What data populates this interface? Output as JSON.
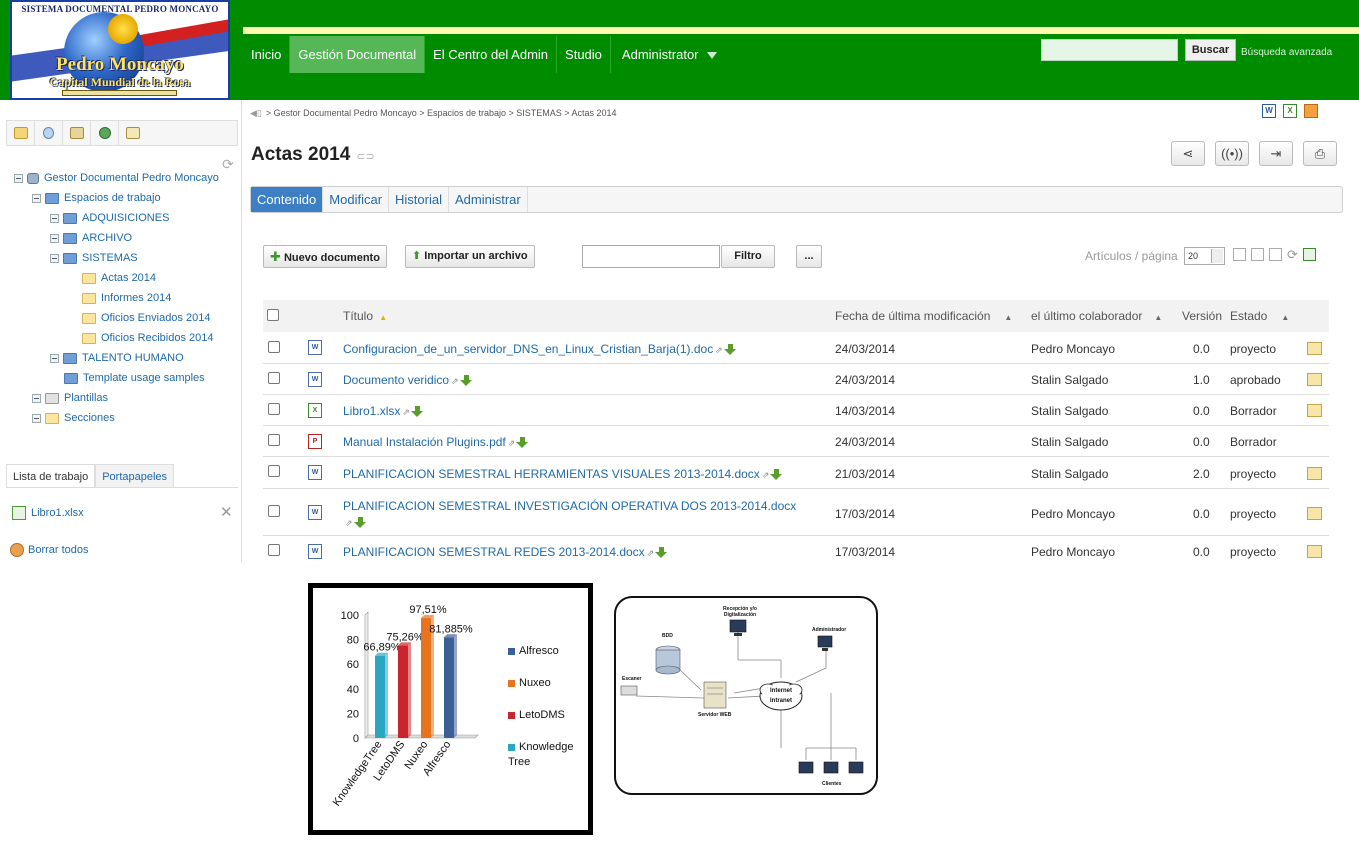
{
  "logo": {
    "top_text": "SISTEMA DOCUMENTAL PEDRO MONCAYO",
    "name": "Pedro Moncayo",
    "tagline": "Capital Mundial de la Rosa"
  },
  "nav": {
    "items": [
      "Inicio",
      "Gestión Documental",
      "El Centro del Admin",
      "Studio",
      "Administrator"
    ],
    "active_index": 1
  },
  "search": {
    "button": "Buscar",
    "advanced": "Búsqueda avanzada",
    "placeholder": ""
  },
  "sidebar": {
    "tree": {
      "root": "Gestor Documental Pedro Moncayo",
      "workspaces": "Espacios de trabajo",
      "adquisiciones": "ADQUISICIONES",
      "archivo": "ARCHIVO",
      "sistemas": "SISTEMAS",
      "actas": "Actas 2014",
      "informes": "Informes 2014",
      "oficios_enviados": "Oficios Enviados 2014",
      "oficios_recibidos": "Oficios Recibidos 2014",
      "talento": "TALENTO HUMANO",
      "template": "Template usage samples",
      "plantillas": "Plantillas",
      "secciones": "Secciones"
    },
    "work_tabs": [
      "Lista de trabajo",
      "Portapapeles"
    ],
    "worklist_item": "Libro1.xlsx",
    "clear_all": "Borrar todos"
  },
  "breadcrumb": "> Gestor Documental Pedro Moncayo > Espacios de trabajo > SISTEMAS > Actas 2014",
  "page_title": "Actas 2014",
  "tabs": [
    "Contenido",
    "Modificar",
    "Historial",
    "Administrar"
  ],
  "toolbar": {
    "new_doc": "Nuevo documento",
    "import": "Importar un archivo",
    "filter": "Filtro",
    "more": "...",
    "per_page_label": "Artículos / página",
    "per_page_value": "20"
  },
  "table": {
    "headers": {
      "title": "Título",
      "modified": "Fecha de última modificación",
      "contributor": "el último colaborador",
      "version": "Versión",
      "state": "Estado"
    },
    "rows": [
      {
        "type": "doc",
        "title": "Configuracion_de_un_servidor_DNS_en_Linux_Cristian_Barja(1).doc",
        "date": "24/03/2014",
        "author": "Pedro Moncayo",
        "version": "0.0",
        "state": "proyecto",
        "editable": true
      },
      {
        "type": "doc",
        "title": "Documento veridico",
        "date": "24/03/2014",
        "author": "Stalin Salgado",
        "version": "1.0",
        "state": "aprobado",
        "editable": true
      },
      {
        "type": "xls",
        "title": "Libro1.xlsx",
        "date": "14/03/2014",
        "author": "Stalin Salgado",
        "version": "0.0",
        "state": "Borrador",
        "editable": true
      },
      {
        "type": "pdf",
        "title": "Manual Instalación Plugins.pdf",
        "date": "24/03/2014",
        "author": "Stalin Salgado",
        "version": "0.0",
        "state": "Borrador",
        "editable": false
      },
      {
        "type": "doc",
        "title": "PLANIFICACION SEMESTRAL HERRAMIENTAS VISUALES 2013-2014.docx",
        "date": "21/03/2014",
        "author": "Stalin Salgado",
        "version": "2.0",
        "state": "proyecto",
        "editable": true
      },
      {
        "type": "doc",
        "title": "PLANIFICACION SEMESTRAL INVESTIGACIÓN OPERATIVA DOS 2013-2014.docx",
        "date": "17/03/2014",
        "author": "Pedro Moncayo",
        "version": "0.0",
        "state": "proyecto",
        "editable": true
      },
      {
        "type": "doc",
        "title": "PLANIFICACION SEMESTRAL REDES 2013-2014.docx",
        "date": "17/03/2014",
        "author": "Pedro Moncayo",
        "version": "0.0",
        "state": "proyecto",
        "editable": true
      }
    ]
  },
  "colors": {
    "header_green": "#008c00",
    "nav_active": "#55b755",
    "link_blue": "#1f6aa7",
    "tab_active": "#3d7fc4"
  },
  "chart_data": {
    "type": "bar",
    "categories": [
      "KnowledgeTree",
      "LetoDMS",
      "Nuxeo",
      "Alfresco"
    ],
    "values": [
      66.89,
      75.26,
      97.51,
      81.885
    ],
    "data_labels": [
      "66,89%",
      "75,26%",
      "97,51%",
      "81,885%"
    ],
    "colors": [
      "#2aa6c0",
      "#c8252c",
      "#e8731e",
      "#3d5f98"
    ],
    "y_ticks": [
      "0",
      "20",
      "40",
      "60",
      "80",
      "100"
    ],
    "ylim": [
      0,
      100
    ],
    "legend": [
      {
        "label": "Alfresco",
        "color": "#3d5f98"
      },
      {
        "label": "Nuxeo",
        "color": "#e8731e"
      },
      {
        "label": "LetoDMS",
        "color": "#c8252c"
      },
      {
        "label": "Knowledge Tree",
        "color": "#2aa6c0"
      }
    ],
    "legend_position": "right",
    "grid": false
  },
  "diagram": {
    "recepcion": "Recepción y/o Digitalización",
    "bdd": "BDD",
    "administrador": "Administrador",
    "escaner": "Escaner",
    "servidor": "Servidor WEB",
    "internet": "Internet",
    "intranet": "Intranet",
    "clientes": "Clientes"
  }
}
